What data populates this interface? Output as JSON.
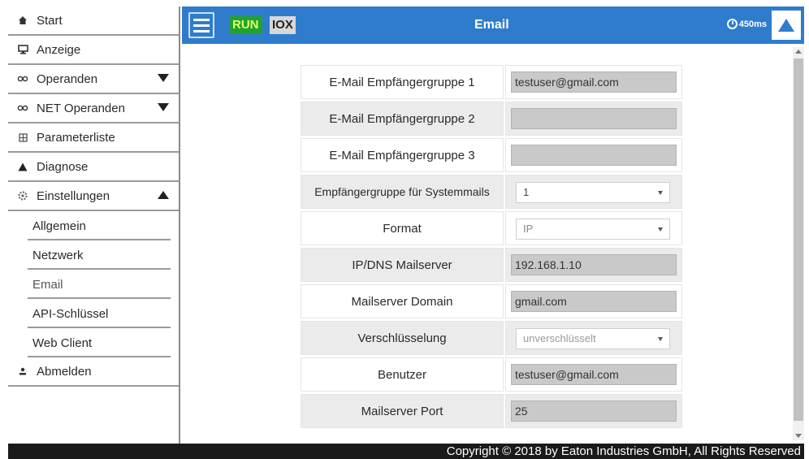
{
  "sidebar": {
    "items": [
      {
        "label": "Start",
        "icon": "home-icon"
      },
      {
        "label": "Anzeige",
        "icon": "monitor-icon"
      },
      {
        "label": "Operanden",
        "icon": "link-icon"
      },
      {
        "label": "NET Operanden",
        "icon": "link-icon"
      },
      {
        "label": "Parameterliste",
        "icon": "table-icon"
      },
      {
        "label": "Diagnose",
        "icon": "warning-icon"
      },
      {
        "label": "Einstellungen",
        "icon": "gear-icon"
      }
    ],
    "settings_sub": [
      {
        "label": "Allgemein"
      },
      {
        "label": "Netzwerk"
      },
      {
        "label": "Email"
      },
      {
        "label": "API-Schlüssel"
      },
      {
        "label": "Web Client"
      }
    ],
    "logout": {
      "label": "Abmelden",
      "icon": "logout-icon"
    }
  },
  "header": {
    "run": "RUN",
    "iox": "IOX",
    "title": "Email",
    "cycle_time": "450ms",
    "accent": "#2f7ccd"
  },
  "form": {
    "group1_label": "E-Mail Empfängergruppe 1",
    "group1_value": "testuser@gmail.com",
    "group2_label": "E-Mail Empfängergruppe 2",
    "group2_value": "",
    "group3_label": "E-Mail Empfängergruppe 3",
    "group3_value": "",
    "sysmail_label": "Empfängergruppe für Systemmails",
    "sysmail_value": "1",
    "format_label": "Format",
    "format_value": "IP",
    "server_label": "IP/DNS Mailserver",
    "server_value": "192.168.1.10",
    "domain_label": "Mailserver Domain",
    "domain_value": "gmail.com",
    "encryption_label": "Verschlüsselung",
    "encryption_value": "unverschlüsselt",
    "user_label": "Benutzer",
    "user_value": "testuser@gmail.com",
    "port_label": "Mailserver Port",
    "port_value": "25"
  },
  "footer": {
    "copyright": "Copyright © 2018 by Eaton Industries GmbH, All Rights Reserved"
  }
}
